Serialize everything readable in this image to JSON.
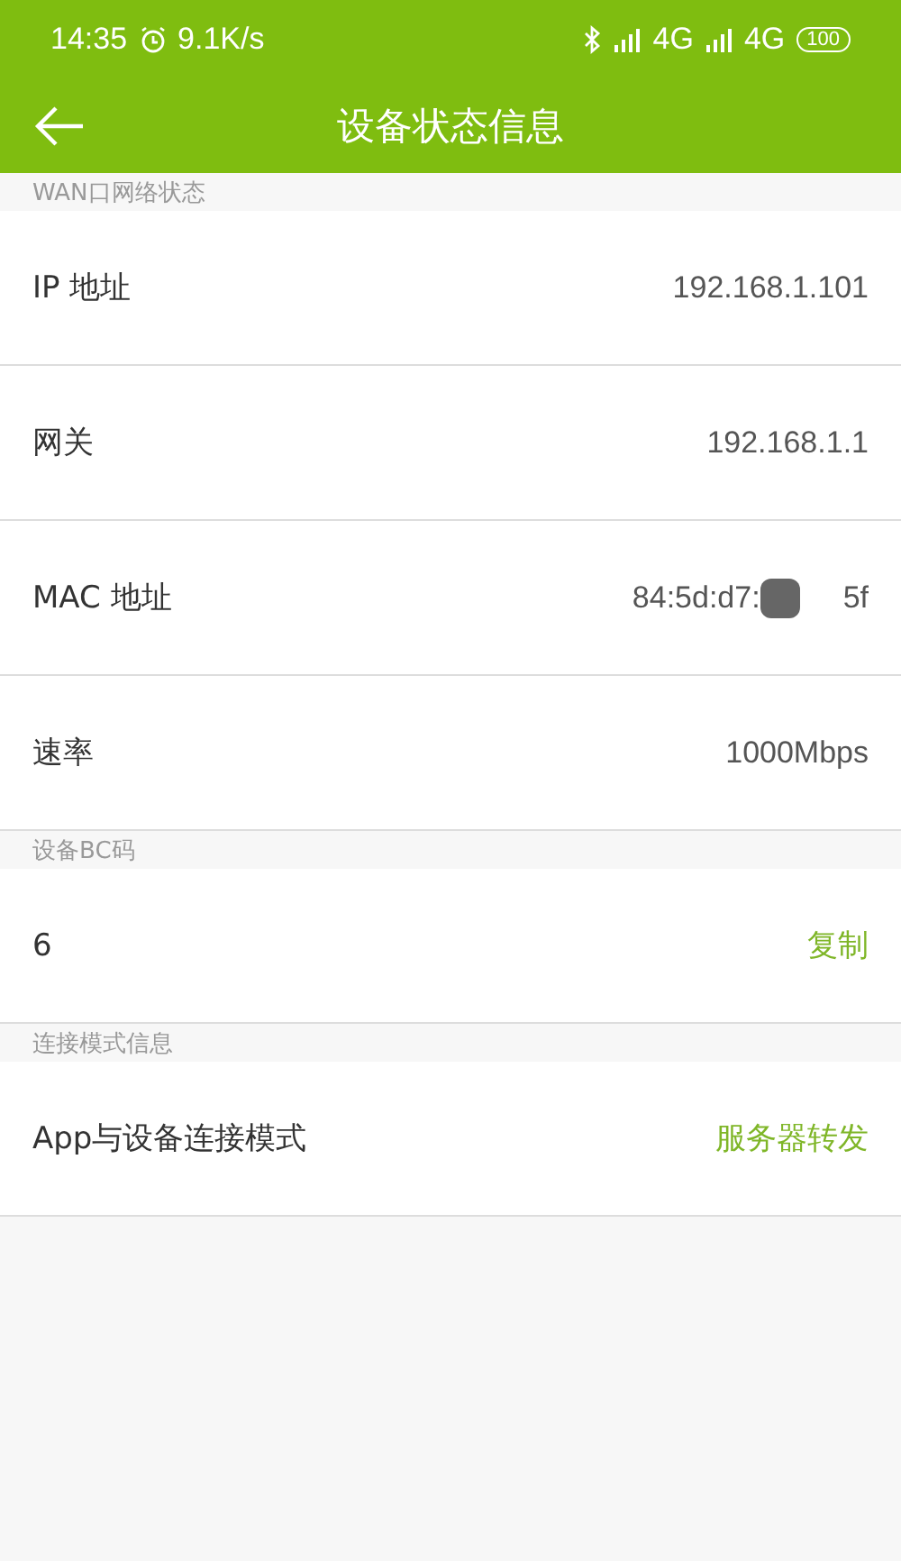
{
  "status_bar": {
    "time": "14:35",
    "speed": "9.1K/s",
    "network_1": "4G",
    "network_2": "4G",
    "battery": "100"
  },
  "header": {
    "title": "设备状态信息"
  },
  "sections": [
    {
      "title": "WAN口网络状态",
      "rows": [
        {
          "kind": "value",
          "label": "IP 地址",
          "value": "192.168.1.101"
        },
        {
          "kind": "value",
          "label": "网关",
          "value": "192.168.1.1"
        },
        {
          "kind": "masked",
          "label": "MAC 地址",
          "value_start": "84:5d:d7:",
          "value_end": "5f"
        },
        {
          "kind": "value",
          "label": "速率",
          "value": "1000Mbps"
        }
      ]
    },
    {
      "title": "设备BC码",
      "rows": [
        {
          "kind": "action",
          "label": "6",
          "value": "复制"
        }
      ]
    },
    {
      "title": "连接模式信息",
      "rows": [
        {
          "kind": "accent",
          "label": "App与设备连接模式",
          "value": "服务器转发"
        }
      ]
    }
  ]
}
